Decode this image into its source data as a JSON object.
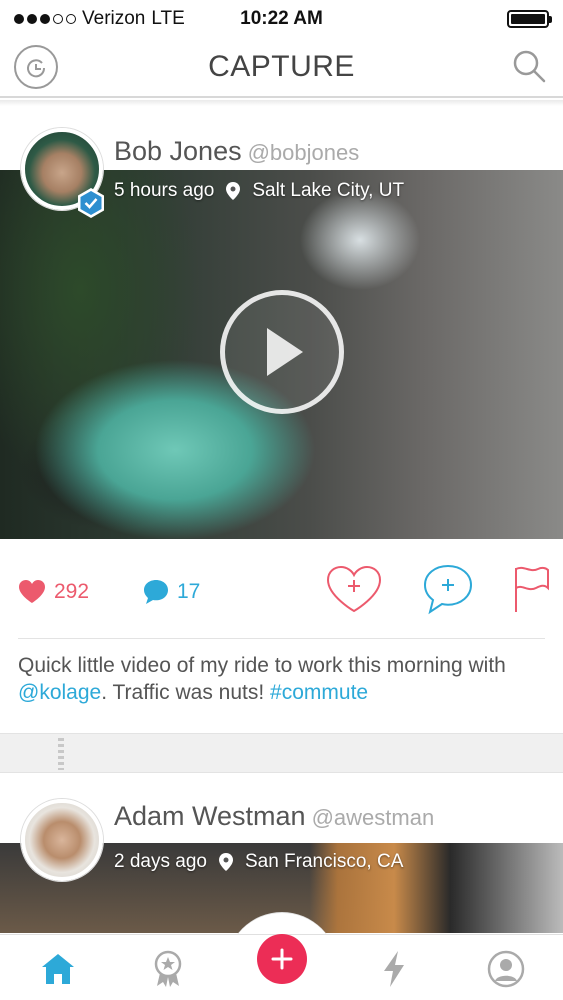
{
  "status_bar": {
    "carrier": "Verizon",
    "network": "LTE",
    "time": "10:22 AM",
    "signal_bars_filled": 3,
    "signal_bars_total": 5,
    "battery_level": 1.0
  },
  "nav": {
    "title": "CAPTURE",
    "left_icon": "refresh-icon",
    "right_icon": "search-icon"
  },
  "posts": [
    {
      "user_name": "Bob Jones",
      "handle": "@bobjones",
      "time_ago": "5 hours ago",
      "location": "Salt Lake City, UT",
      "verified": true,
      "media_type": "video",
      "likes": "292",
      "comments": "17",
      "caption": {
        "text_1": "Quick little video of my ride to work this morning with ",
        "mention": "@kolage",
        "text_2": ". Traffic was nuts! ",
        "hashtag": "#commute"
      }
    },
    {
      "user_name": "Adam Westman",
      "handle": "@awestman",
      "time_ago": "2 days ago",
      "location": "San Francisco, CA"
    }
  ],
  "tabs": [
    "home-icon",
    "ranking-badge-icon",
    "add-icon",
    "activity-bolt-icon",
    "profile-icon"
  ],
  "colors": {
    "accent_blue": "#2da9d8",
    "like_red": "#ec5a6d",
    "fab_red": "#ec2d56"
  }
}
